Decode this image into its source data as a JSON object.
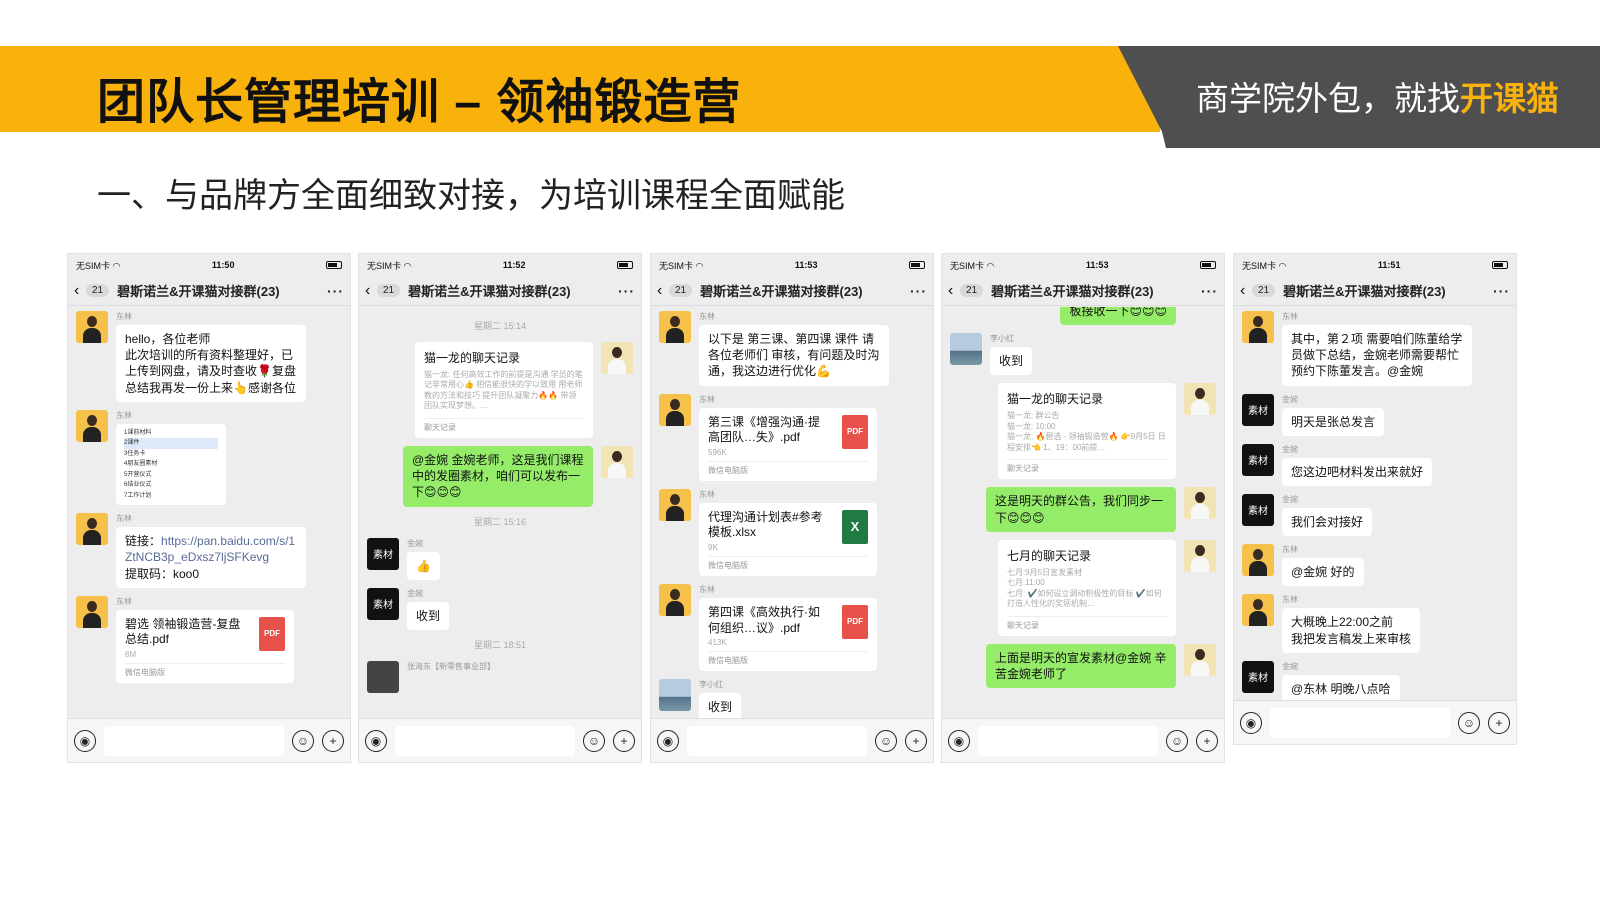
{
  "header": {
    "title": "团队长管理培训 – 领袖锻造营",
    "slogan_prefix": "商学院外包，就找",
    "slogan_brand": "开课猫",
    "subtitle": "一、与品牌方全面细致对接，为培训课程全面赋能"
  },
  "common": {
    "carrier": "无SIM卡",
    "group_name": "碧斯诺兰&开课猫对接群(23)",
    "unread": "21",
    "back_icon": "chevron-left-icon",
    "more_icon": "more-icon",
    "voice_icon": "voice-icon",
    "emoji_icon": "emoji-icon",
    "plus_icon": "plus-icon"
  },
  "phones": [
    {
      "time": "11:50",
      "msgs": {
        "m1_name": "东林",
        "m1_text": "hello，各位老师\n此次培训的所有资料整理好，已上传到网盘，请及时查收🌹复盘总结我再发一份上来👆感谢各位",
        "m2_name": "东林",
        "m2_list": [
          "1课前材料",
          "2课件",
          "3任务卡",
          "4朋友圈素材",
          "5开营仪式",
          "6结业仪式",
          "7工作计划"
        ],
        "m3_name": "东林",
        "m3_label": "链接：",
        "m3_link": "https://pan.baidu.com/s/1ZtNCB3p_eDxsz7ljSFKevg",
        "m3_code": "提取码：koo0",
        "m4_name": "东林",
        "m4_file": "碧选 领袖锻造营-复盘总结.pdf",
        "m4_size": "8M",
        "m4_type": "PDF",
        "m4_foot": "微信电脑版"
      }
    },
    {
      "time": "11:52",
      "msgs": {
        "t1": "星期二 15:14",
        "c1_title": "猫一龙的聊天记录",
        "c1_body": "猫一龙: 任何高效工作的前提是沟通 学员的笔记非常用心👍 相信能很快的学以致用 用老师教的方法和技巧 提升团队凝聚力🔥🔥 带领团队实现梦想。…",
        "c1_foot": "聊天记录",
        "g1_text": "@金婉 金婉老师，这是我们课程中的发圈素材，咱们可以发布一下😊😊😊",
        "t2": "星期二 15:16",
        "j1_name": "金婉",
        "j1_emoji": "👍",
        "j2_name": "金婉",
        "j2_text": "收到",
        "t3": "星期二 18:51",
        "z_name": "张海东【新零售事业部】",
        "avatar_text": "素材"
      }
    },
    {
      "time": "11:53",
      "msgs": {
        "a_name": "东林",
        "a_text": "以下是 第三课、第四课 课件 请各位老师们 审核，有问题及时沟通，我这边进行优化💪",
        "f1_name": "东林",
        "f1_file": "第三课《增强沟通·提高团队…失》.pdf",
        "f1_size": "596K",
        "f1_type": "PDF",
        "f2_name": "东林",
        "f2_file": "代理沟通计划表#参考模板.xlsx",
        "f2_size": "9K",
        "f2_type": "X",
        "f3_name": "东林",
        "f3_file": "第四课《高效执行·如何组织…议》.pdf",
        "f3_size": "413K",
        "f3_type": "PDF",
        "foot": "微信电脑版",
        "last_name": "李小红",
        "last_text": "收到"
      }
    },
    {
      "time": "11:53",
      "msgs": {
        "top_text": "板接收一下😊😊😊",
        "r1_name": "李小红",
        "r1_text": "收到",
        "c1_title": "猫一龙的聊天记录",
        "c1_body": "猫一龙: 群公告\n猫一龙: 10:00\n猫一龙: 🔥碧选 · 领袖锻造营🔥 👉9月5日 日程安排👈 1、19：00前提…",
        "c1_foot": "聊天记录",
        "g1_text": "这是明天的群公告，我们同步一下😊😊😊",
        "c2_title": "七月的聊天记录",
        "c2_body": "七月:9月5日宣发素材\n七月:11:00\n七月: ✔️如何设立调动积极性的目标 ✔️如何打造人性化的奖惩机制…",
        "c2_foot": "聊天记录",
        "g2_text": "上面是明天的宣发素材@金婉 辛苦金婉老师了"
      }
    },
    {
      "time": "11:51",
      "msgs": {
        "a_name": "东林",
        "a_text": "其中，第２项 需要咱们陈董给学员做下总结，金婉老师需要帮忙预约下陈董发言。@金婉",
        "b_name": "金婉",
        "b_text": "明天是张总发言",
        "c_name": "金婉",
        "c_text": "您这边吧材料发出来就好",
        "d_name": "金婉",
        "d_text": "我们会对接好",
        "e_name": "东林",
        "e_text": "@金婉 好的",
        "f_name": "东林",
        "f_text": "大概晚上22:00之前\n我把发言稿发上来审核",
        "g_name": "金婉",
        "g_text": "@东林 明晚八点哈",
        "avatar_text": "素材"
      }
    }
  ]
}
